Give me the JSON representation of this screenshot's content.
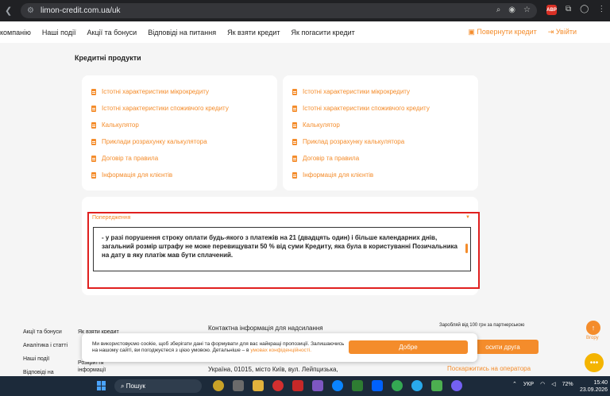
{
  "browser": {
    "url": "limon-credit.com.ua/uk",
    "ext_abp": "ABP"
  },
  "nav": {
    "items": [
      "компанію",
      "Наші події",
      "Акції та бонуси",
      "Відповіді на питання",
      "Як взяти кредит",
      "Як погасити кредит"
    ],
    "return_credit": "Повернути кредит",
    "login": "Увійти"
  },
  "section": {
    "title": "Кредитні продукти"
  },
  "left_card": {
    "links": [
      "Істотні характеристики мікрокредиту",
      "Істотні характеристики споживчого кредиту",
      "Калькулятор",
      "Приклади розрахунку калькулятора",
      "Договір та правила",
      "Інформація для клієнтів"
    ]
  },
  "right_card": {
    "links": [
      "Істотні характеристики мікрокредиту",
      "Істотні характеристики споживчого кредиту",
      "Калькулятор",
      "Приклад розрахунку калькулятора",
      "Договір та правила",
      "Інформація для клієнтів"
    ]
  },
  "warning": {
    "title": "Попередження",
    "text": "- у разі порушення строку оплати будь-якого з платежів на 21 (двадцять один) і більше календарних днів, загальний розмір штрафу не може перевищувати 50 % від суми Кредиту, яка була в користуванні Позичальника на дату в яку платіж мав бути сплачений."
  },
  "footer": {
    "col1": [
      "Акції та бонуси",
      "Аналітика і статті",
      "Наші події",
      "Відповіді на"
    ],
    "col2": [
      "Як взяти кредит",
      "Розкриття інформації"
    ],
    "contact_title": "Контактна інформація для надсилання",
    "address": "Україна, 01015, місто Київ, вул. Лейпцизька,",
    "partner_note": "Заробляй від 100 грн за партнерською",
    "invite_btn": "осити друга",
    "complaint": "Поскаржитись на оператора",
    "up_label": "Вгору"
  },
  "cookie": {
    "text": "Ми використовуємо cookie, щоб зберігати дані та формувати для вас найкращі пропозиції. Залишаючись на нашому сайті, ви погоджуєтеся з цією умовою. Детальніше – в",
    "link": "умовах конфіденційності.",
    "button": "Добре"
  },
  "taskbar": {
    "search": "Пошук",
    "lang": "УКР",
    "battery": "72%",
    "time": "15:40",
    "date": "23.09.2026"
  },
  "colors": {
    "accent": "#f48c2b",
    "warning_border": "#e0201f"
  }
}
